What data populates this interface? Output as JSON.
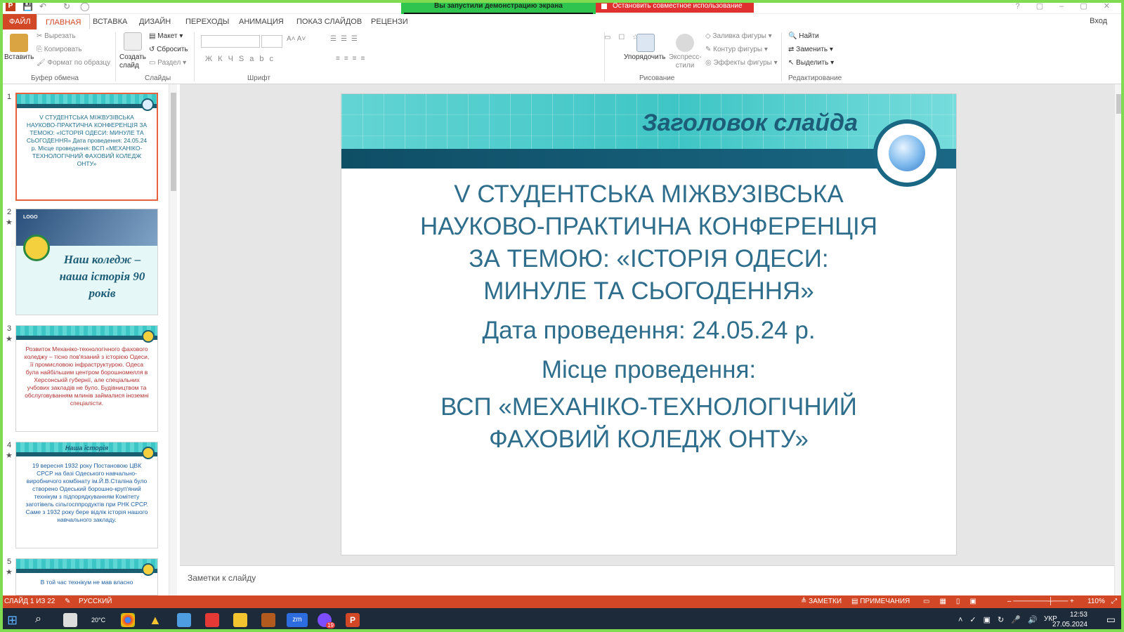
{
  "titlebar": {
    "share_banner": "Вы запустили демонстрацию экрана",
    "stop_share": "Остановить совместное использование"
  },
  "ribbon": {
    "tabs": [
      "ФАЙЛ",
      "ГЛАВНАЯ",
      "ВСТАВКА",
      "ДИЗАЙН",
      "ПЕРЕХОДЫ",
      "АНИМАЦИЯ",
      "ПОКАЗ СЛАЙДОВ",
      "РЕЦЕНЗИ"
    ],
    "login": "Вход",
    "paste": "Вставить",
    "cut": "Вырезать",
    "copy": "Копировать",
    "format_painter": "Формат по образцу",
    "clipboard_group": "Буфер обмена",
    "new_slide": "Создать слайд",
    "layout": "Макет",
    "reset": "Сбросить",
    "section": "Раздел",
    "slides_group": "Слайды",
    "font_group": "Шрифт",
    "arrange": "Упорядочить",
    "quick_styles": "Экспресс-стили",
    "shape_fill": "Заливка фигуры",
    "shape_outline": "Контур фигуры",
    "shape_effects": "Эффекты фигуры",
    "drawing_group": "Рисование",
    "find": "Найти",
    "replace": "Заменить",
    "select": "Выделить",
    "editing_group": "Редактирование"
  },
  "thumbnails": [
    {
      "num": "1",
      "text": "V СТУДЕНТСЬКА МІЖВУЗІВСЬКА НАУКОВО-ПРАКТИЧНА КОНФЕРЕНЦІЯ ЗА ТЕМОЮ: «ІСТОРІЯ ОДЕСИ: МИНУЛЕ ТА СЬОГОДЕННЯ» Дата проведення: 24.05.24 р. Місце проведення: ВСП «МЕХАНІКО-ТЕХНОЛОГІЧНИЙ ФАХОВИЙ КОЛЕДЖ ОНТУ»"
    },
    {
      "num": "2",
      "title": "Наш коледж – наша історія 90 років",
      "logo": "LOGO"
    },
    {
      "num": "3",
      "text": "Розвиток Механіко-технологічного фахового коледжу – тісно пов'язаний з історією Одеси, її промисловою інфраструктурою. Одеса була найбільшим центром борошномелля в Херсонській губернії, але спеціальних учбових закладів не було. Будівництвом та обслуговуванням млинів займалися іноземні спеціалісти."
    },
    {
      "num": "4",
      "title": "Наша історія",
      "text": "19 вересня 1932 року Постановою ЦВК СРСР на базі Одеського навчально-виробничого комбінату ім.Й.В.Сталіна було створено Одеський борошно-круп'яний технікум з підпорядкуванням Комітету заготівель сільгосппродуктів при РНК СРСР. Саме з 1932 року бере відлік історія нашого навчального закладу."
    },
    {
      "num": "5",
      "text": "В той час технікум не мав власно"
    }
  ],
  "slide": {
    "title": "Заголовок слайда",
    "line1": "V СТУДЕНТСЬКА МІЖВУЗІВСЬКА",
    "line2": "НАУКОВО-ПРАКТИЧНА КОНФЕРЕНЦІЯ",
    "line3": "ЗА ТЕМОЮ: «ІСТОРІЯ ОДЕСИ:",
    "line4": "МИНУЛЕ ТА СЬОГОДЕННЯ»",
    "date": "Дата проведення: 24.05.24 р.",
    "place_label": "Місце проведення:",
    "place1": "ВСП «МЕХАНІКО-ТЕХНОЛОГІЧНИЙ",
    "place2": "ФАХОВИЙ КОЛЕДЖ ОНТУ»"
  },
  "notes_placeholder": "Заметки к слайду",
  "statusbar": {
    "slide_info": "СЛАЙД 1 ИЗ 22",
    "language": "РУССКИЙ",
    "notes": "ЗАМЕТКИ",
    "comments": "ПРИМЕЧАНИЯ",
    "zoom": "110%"
  },
  "taskbar": {
    "weather": "20°C",
    "lang": "УКР",
    "time": "12:53",
    "date": "27.05.2024",
    "badge": "19"
  },
  "colors": {
    "accent": "#d24726",
    "slide_text": "#2e6e8c",
    "share_green": "#2fc44e",
    "stop_red": "#e03131"
  }
}
